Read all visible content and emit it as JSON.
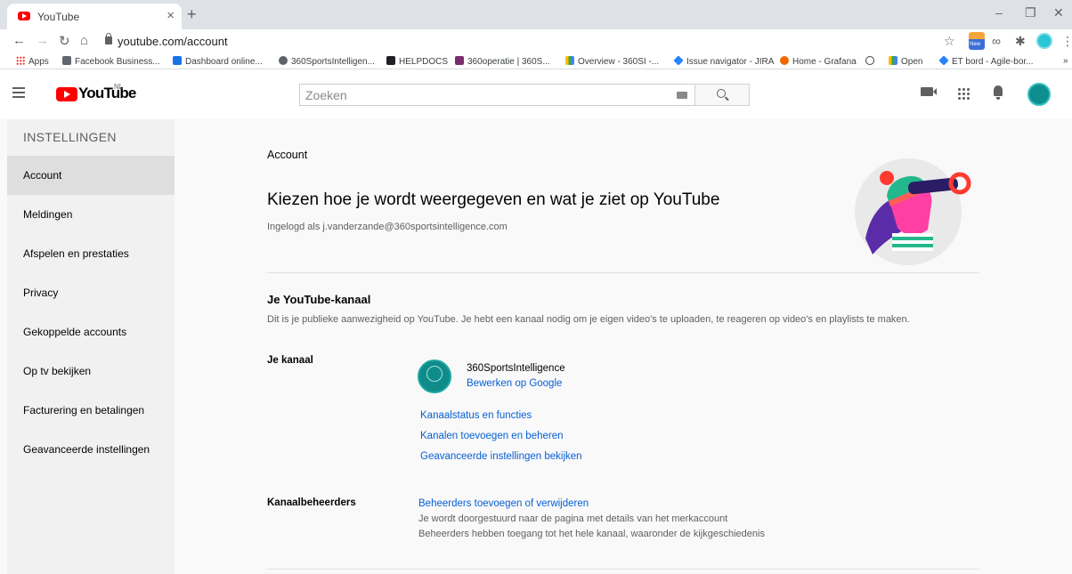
{
  "browser": {
    "tab_title": "YouTube",
    "url": "youtube.com/account",
    "bookmarks": [
      "Apps",
      "Facebook Business...",
      "Dashboard online...",
      "360SportsIntelligen...",
      "HELPDOCS",
      "360operatie | 360S...",
      "Overview - 360SI -...",
      "Issue navigator - JIRA",
      "Home - Grafana",
      "Open",
      "ET bord - Agile-bor...",
      "»"
    ],
    "ext_new_label": "New"
  },
  "header": {
    "logo_text": "YouTube",
    "country_code": "NL",
    "search_placeholder": "Zoeken"
  },
  "sidebar": {
    "heading": "INSTELLINGEN",
    "items": [
      {
        "label": "Account",
        "active": true
      },
      {
        "label": "Meldingen"
      },
      {
        "label": "Afspelen en prestaties"
      },
      {
        "label": "Privacy"
      },
      {
        "label": "Gekoppelde accounts"
      },
      {
        "label": "Op tv bekijken"
      },
      {
        "label": "Facturering en betalingen"
      },
      {
        "label": "Geavanceerde instellingen"
      }
    ]
  },
  "main": {
    "section_title": "Account",
    "headline": "Kiezen hoe je wordt weergegeven en wat je ziet op YouTube",
    "signed_in": "Ingelogd als j.vanderzande@360sportsintelligence.com",
    "channel_section": {
      "title": "Je YouTube-kanaal",
      "description": "Dit is je publieke aanwezigheid op YouTube. Je hebt een kanaal nodig om je eigen video's te uploaden, te reageren op video's en playlists te maken.",
      "your_channel_label": "Je kanaal",
      "channel_name": "360SportsIntelligence",
      "edit_link": "Bewerken op Google",
      "links": [
        "Kanaalstatus en functies",
        "Kanalen toevoegen en beheren",
        "Geavanceerde instellingen bekijken"
      ]
    },
    "managers": {
      "label": "Kanaalbeheerders",
      "link": "Beheerders toevoegen of verwijderen",
      "note_1": "Je wordt doorgestuurd naar de pagina met details van het merkaccount",
      "note_2": "Beheerders hebben toegang tot het hele kanaal, waaronder de kijkgeschiedenis"
    }
  },
  "colors": {
    "link": "#065fd4",
    "brand_red": "#ff0000",
    "sidebar_bg": "#f1f1f1",
    "active_item_bg": "#dedede"
  }
}
